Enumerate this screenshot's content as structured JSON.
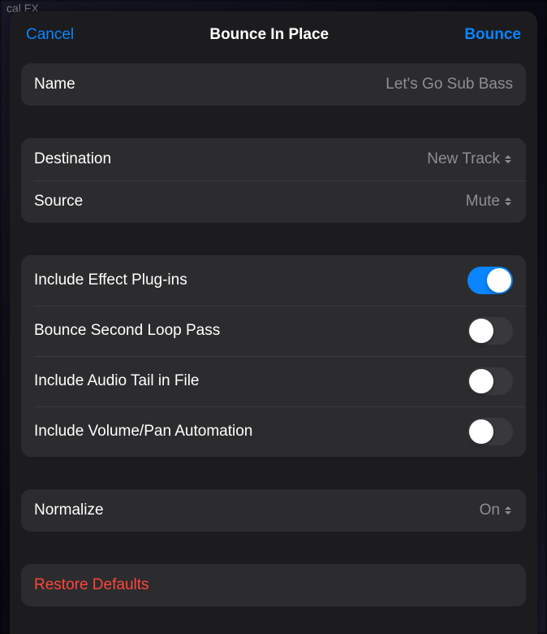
{
  "background_hint": "cal FX",
  "header": {
    "cancel": "Cancel",
    "title": "Bounce In Place",
    "confirm": "Bounce"
  },
  "name_row": {
    "label": "Name",
    "value": "Let's Go Sub Bass"
  },
  "routing": {
    "destination_label": "Destination",
    "destination_value": "New Track",
    "source_label": "Source",
    "source_value": "Mute"
  },
  "options": [
    {
      "label": "Include Effect Plug-ins",
      "on": true
    },
    {
      "label": "Bounce Second Loop Pass",
      "on": false
    },
    {
      "label": "Include Audio Tail in File",
      "on": false
    },
    {
      "label": "Include Volume/Pan Automation",
      "on": false
    }
  ],
  "normalize": {
    "label": "Normalize",
    "value": "On"
  },
  "restore": "Restore Defaults"
}
